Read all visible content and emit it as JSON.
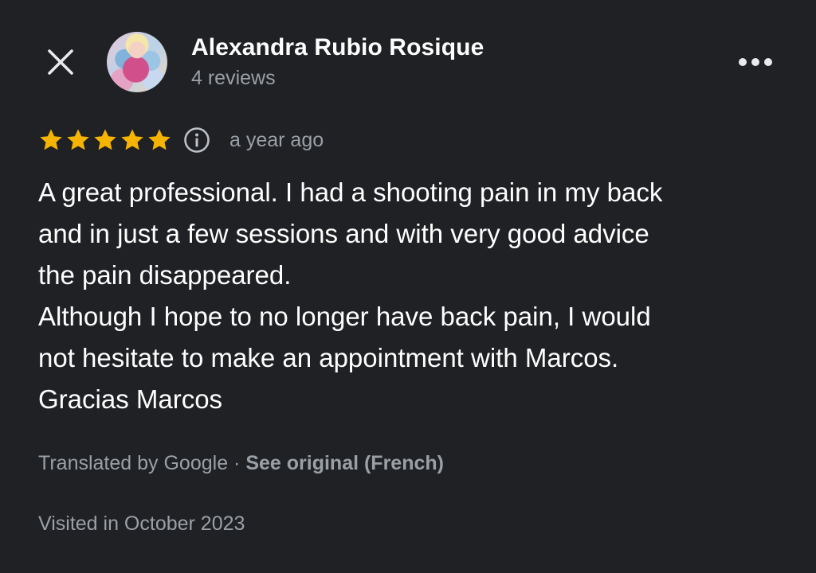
{
  "header": {
    "close_icon": "close-icon",
    "author_name": "Alexandra Rubio Rosique",
    "review_count": "4 reviews",
    "more_icon": "more-horizontal-icon"
  },
  "rating": {
    "stars": 5,
    "max_stars": 5,
    "star_color": "#F4B400",
    "info_icon": "info-icon",
    "time_ago": "a year ago"
  },
  "review": {
    "lines": [
      "A great professional. I had a shooting pain in my back",
      "and in just a few sessions and with very good advice",
      "the pain disappeared.",
      "Although I hope to no longer have back pain, I would",
      "not hesitate to make an appointment with Marcos.",
      "Gracias Marcos"
    ]
  },
  "translation": {
    "translated_by": "Translated by Google",
    "separator": " · ",
    "see_original": "See original (French)"
  },
  "visited": "Visited in October 2023",
  "colors": {
    "background": "#202124",
    "primary_text": "#FFFFFF",
    "secondary_text": "#9AA0A6"
  }
}
